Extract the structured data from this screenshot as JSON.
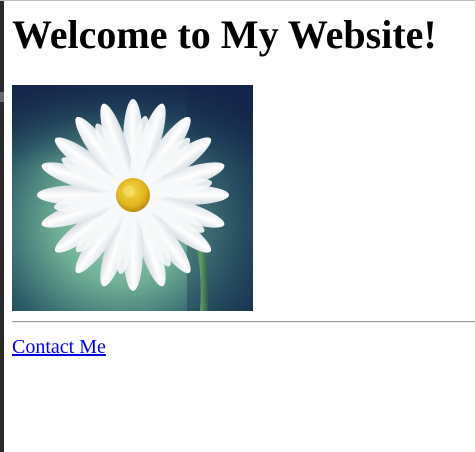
{
  "page": {
    "heading": "Welcome to My Website!",
    "image": {
      "subject": "white daisy flower on teal-green blurred background",
      "colors": {
        "background_dark": "#14254a",
        "background_mid": "#5e9e8a",
        "petals": "#f1f3f5",
        "center": "#e0b41e",
        "stem": "#3f7a52"
      }
    },
    "link": {
      "label": "Contact Me",
      "color": "#0000ee"
    }
  }
}
